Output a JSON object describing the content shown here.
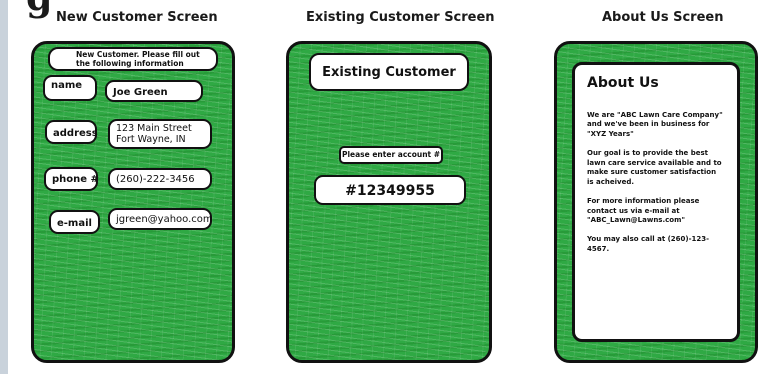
{
  "header": {
    "corner_text": "g"
  },
  "titles": {
    "new": "New Customer Screen",
    "existing": "Existing Customer Screen",
    "about": "About Us Screen"
  },
  "new_customer": {
    "instructions": "New Customer.  Please fill out the following information",
    "fields": [
      {
        "label": "name",
        "value": "Joe Green"
      },
      {
        "label": "address",
        "value": "123 Main Street\nFort Wayne, IN"
      },
      {
        "label": "phone #",
        "value": "(260)-222-3456"
      },
      {
        "label": "e-mail",
        "value": "jgreen@yahoo.com"
      }
    ]
  },
  "existing_customer": {
    "heading": "Existing Customer",
    "prompt": "Please enter account #",
    "account": "#12349955"
  },
  "about": {
    "heading": "About Us",
    "paragraphs": [
      "We are \"ABC Lawn Care Company\" and we've been in business for \"XYZ Years\"",
      "Our goal is to provide the best lawn care service available and to make sure customer satisfaction is acheived.",
      "For more information please contact us via e-mail at \"ABC_Lawn@Lawns.com\"",
      "You may also call at (260)-123-4567."
    ]
  },
  "colors": {
    "grass": "#2fa944",
    "outline": "#111111"
  }
}
